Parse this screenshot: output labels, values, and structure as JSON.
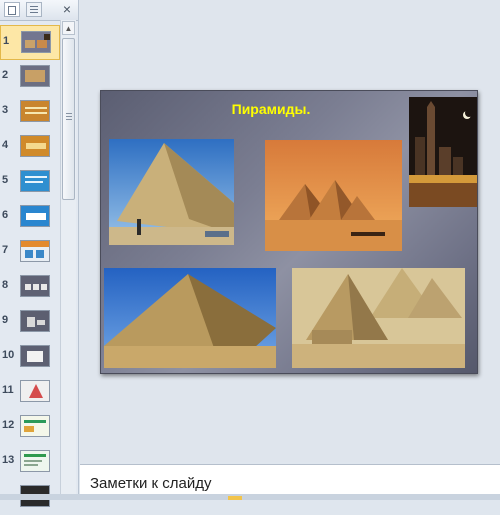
{
  "thumbnail_pane": {
    "slides": [
      {
        "number": "1",
        "selected": true
      },
      {
        "number": "2"
      },
      {
        "number": "3"
      },
      {
        "number": "4"
      },
      {
        "number": "5"
      },
      {
        "number": "6"
      },
      {
        "number": "7"
      },
      {
        "number": "8"
      },
      {
        "number": "9"
      },
      {
        "number": "10"
      },
      {
        "number": "11"
      },
      {
        "number": "12"
      },
      {
        "number": "13"
      }
    ],
    "close_glyph": "×"
  },
  "slide": {
    "title": "Пирамиды.",
    "photos": [
      {
        "icon": "pyramid-photo"
      },
      {
        "icon": "pyramids-camels-photo"
      },
      {
        "icon": "night-city-photo"
      },
      {
        "icon": "pyramid-photo"
      },
      {
        "icon": "pyramids-photo"
      }
    ],
    "colors": {
      "title": "#ffff00",
      "background": "#7b7e92"
    }
  },
  "notes": {
    "placeholder": "Заметки к слайду"
  },
  "colors": {
    "selection": "#fde7a6",
    "pane_background": "#e3e9f1"
  }
}
